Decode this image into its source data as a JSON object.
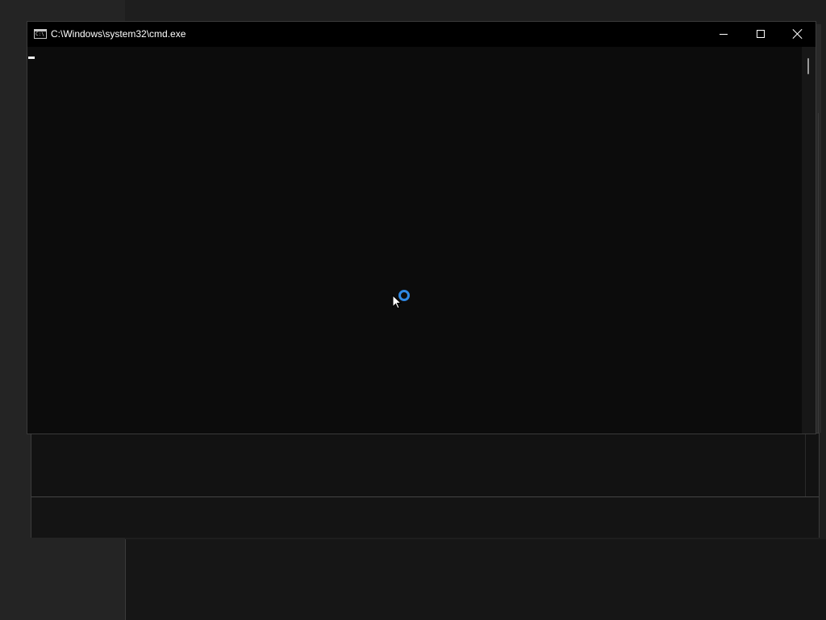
{
  "cmd_window": {
    "title": "C:\\Windows\\system32\\cmd.exe",
    "icon": "console-app-icon",
    "icon_text": "C:\\",
    "buttons": {
      "minimize_icon": "minimize-icon",
      "maximize_icon": "maximize-icon",
      "close_icon": "close-icon"
    }
  },
  "console": {
    "output": "",
    "cursor": "blinking-underscore"
  },
  "pointer": {
    "state": "working-in-background"
  },
  "colors": {
    "console_bg": "#0c0c0c",
    "titlebar_bg": "#000000",
    "busy_accent": "#2f88e3"
  }
}
